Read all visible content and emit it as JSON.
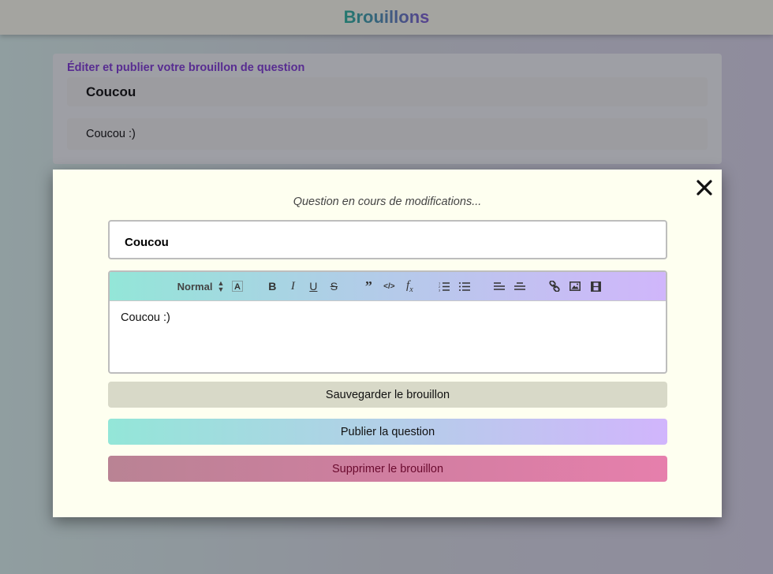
{
  "header": {
    "title": "Brouillons"
  },
  "draft_card": {
    "heading": "Éditer et publier votre brouillon de question",
    "title": "Coucou",
    "body": "Coucou :)"
  },
  "modal": {
    "close_icon": "close-icon",
    "status_text": "Question en cours de modifications...",
    "title_input_value": "Coucou",
    "editor": {
      "toolbar": {
        "header_select_value": "Normal",
        "buttons": [
          {
            "name": "background-color",
            "icon": "highlight-icon",
            "glyph": "A"
          },
          {
            "name": "bold",
            "icon": "bold-icon",
            "glyph": "B"
          },
          {
            "name": "italic",
            "icon": "italic-icon",
            "glyph": "I"
          },
          {
            "name": "underline",
            "icon": "underline-icon",
            "glyph": "U"
          },
          {
            "name": "strike",
            "icon": "strikethrough-icon",
            "glyph": "S"
          },
          {
            "name": "blockquote",
            "icon": "quote-icon",
            "glyph": "❞"
          },
          {
            "name": "code-block",
            "icon": "code-icon",
            "glyph": "‹/›"
          },
          {
            "name": "formula",
            "icon": "formula-icon",
            "glyph": "fx"
          },
          {
            "name": "ordered-list",
            "icon": "ordered-list-icon"
          },
          {
            "name": "bullet-list",
            "icon": "bullet-list-icon"
          },
          {
            "name": "align-left",
            "icon": "align-left-icon"
          },
          {
            "name": "align-center",
            "icon": "align-center-icon"
          },
          {
            "name": "link",
            "icon": "link-icon"
          },
          {
            "name": "image",
            "icon": "image-icon"
          },
          {
            "name": "video",
            "icon": "video-icon"
          }
        ]
      },
      "content": "Coucou :)"
    },
    "buttons": {
      "save": "Sauvegarder le brouillon",
      "publish": "Publier la question",
      "delete": "Supprimer le brouillon"
    }
  },
  "colors": {
    "accent_teal": "#1fb39a",
    "accent_purple": "#7a54d4",
    "heading_purple": "#7a2fd6",
    "modal_bg": "#fefff0",
    "save_bg": "#d8d9c8",
    "delete_text": "#6a0a2e"
  }
}
